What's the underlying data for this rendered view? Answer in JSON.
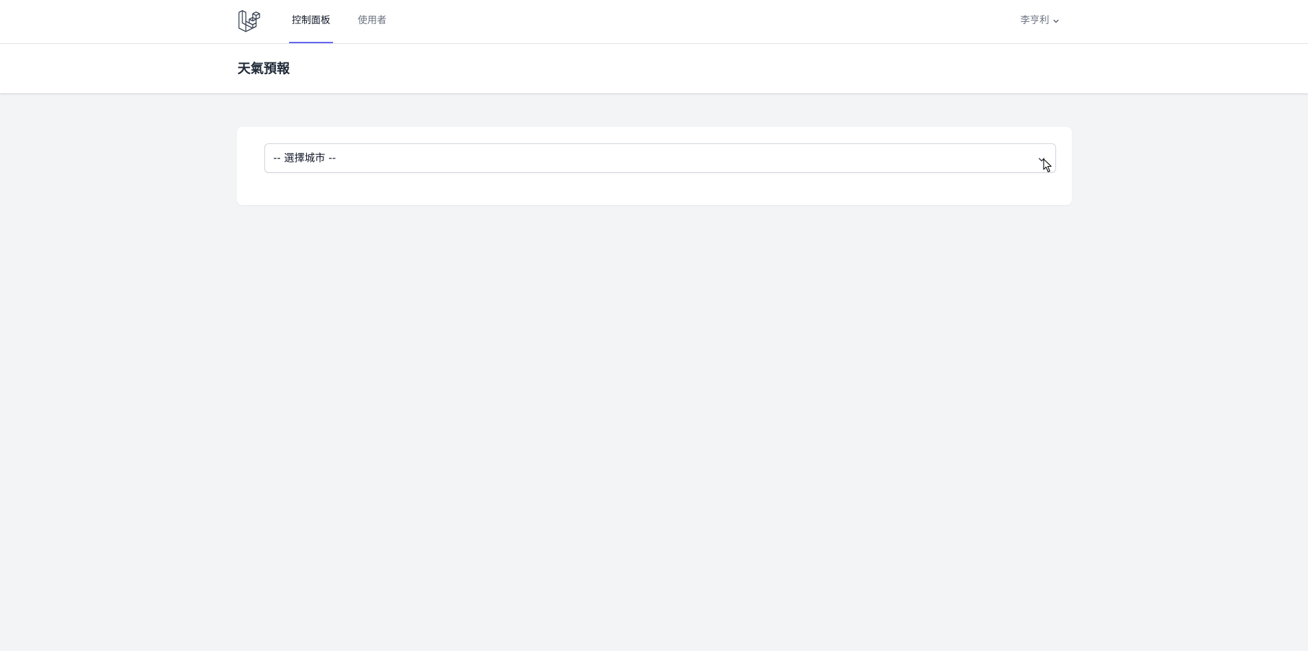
{
  "nav": {
    "logo_icon": "laravel-logo-icon",
    "links": [
      {
        "label": "控制面板",
        "active": true
      },
      {
        "label": "使用者",
        "active": false
      }
    ],
    "user_name": "李亨利",
    "user_chevron_icon": "chevron-down-icon"
  },
  "header": {
    "title": "天氣預報"
  },
  "main": {
    "city_select": {
      "selected": "-- 選擇城市 --",
      "chevron_icon": "chevron-down-icon"
    }
  },
  "colors": {
    "accent": "#6366f1",
    "page_background": "#f3f4f6",
    "surface": "#ffffff"
  }
}
